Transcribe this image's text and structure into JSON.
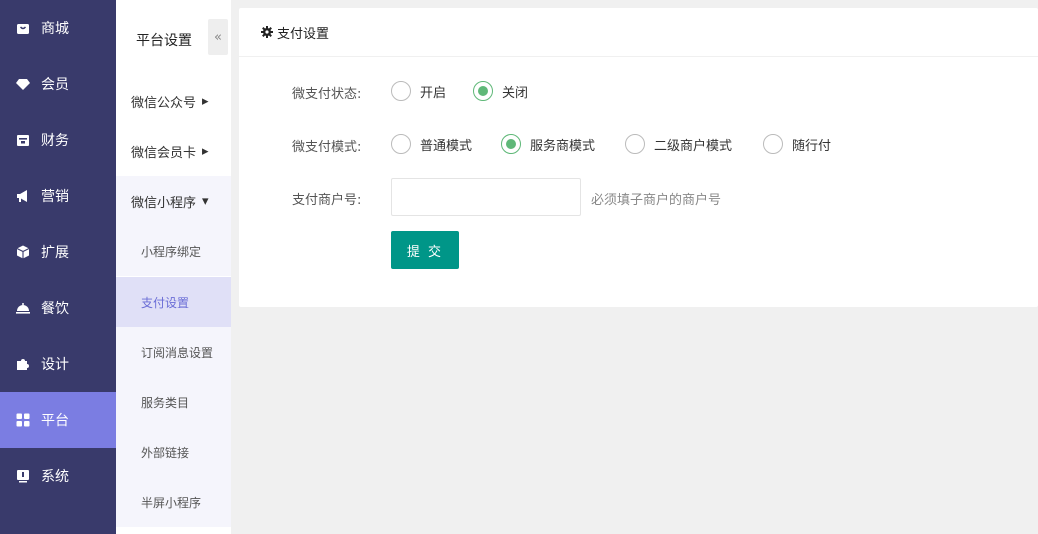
{
  "sidebar": {
    "items": [
      {
        "label": "商城",
        "icon": "shop-bag-icon"
      },
      {
        "label": "会员",
        "icon": "diamond-icon"
      },
      {
        "label": "财务",
        "icon": "wallet-icon"
      },
      {
        "label": "营销",
        "icon": "megaphone-icon"
      },
      {
        "label": "扩展",
        "icon": "cube-icon"
      },
      {
        "label": "餐饮",
        "icon": "cloche-icon"
      },
      {
        "label": "设计",
        "icon": "puzzle-icon"
      },
      {
        "label": "平台",
        "icon": "grid-icon",
        "active": true
      },
      {
        "label": "系统",
        "icon": "monitor-icon"
      }
    ],
    "active_color": "#7b7de2",
    "bg_color": "#393a6b"
  },
  "subnav": {
    "title": "平台设置",
    "collapse_glyph": "«",
    "groups": [
      {
        "label": "微信公众号",
        "caret": "▸"
      },
      {
        "label": "微信会员卡",
        "caret": "▸"
      },
      {
        "label": "微信小程序",
        "caret": "▾"
      }
    ],
    "items": [
      {
        "label": "小程序绑定"
      },
      {
        "label": "支付设置",
        "active": true
      },
      {
        "label": "订阅消息设置"
      },
      {
        "label": "服务类目"
      },
      {
        "label": "外部链接"
      },
      {
        "label": "半屏小程序"
      }
    ]
  },
  "card": {
    "title": "支付设置",
    "status": {
      "label": "微支付状态:",
      "options": [
        "开启",
        "关闭"
      ],
      "selected": "关闭"
    },
    "mode": {
      "label": "微支付模式:",
      "options": [
        "普通模式",
        "服务商模式",
        "二级商户模式",
        "随行付"
      ],
      "selected": "服务商模式"
    },
    "merchant": {
      "label": "支付商户号:",
      "value": "",
      "hint": "必须填子商户的商户号"
    },
    "submit_label": "提 交",
    "accent_color": "#009688",
    "radio_color": "#5fb878"
  }
}
